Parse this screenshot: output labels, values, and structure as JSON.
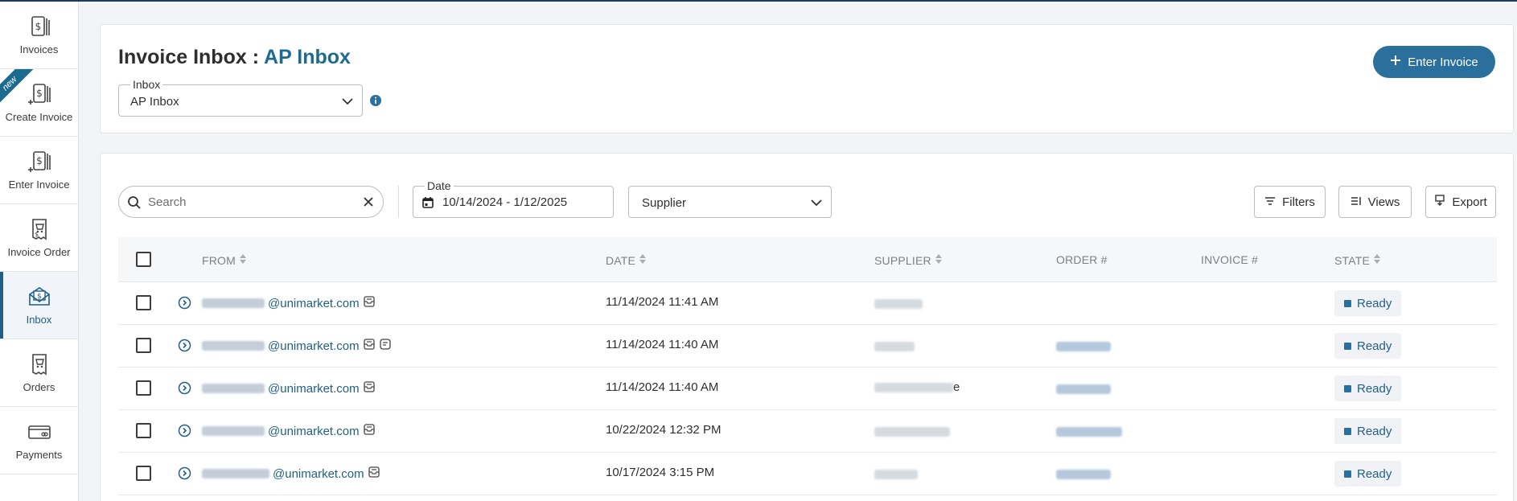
{
  "sidebar": {
    "items": [
      {
        "label": "Invoices",
        "icon": "invoices-icon"
      },
      {
        "label": "Create Invoice",
        "icon": "create-invoice-icon",
        "badge": "new"
      },
      {
        "label": "Enter Invoice",
        "icon": "enter-invoice-icon"
      },
      {
        "label": "Invoice Order",
        "icon": "invoice-order-icon"
      },
      {
        "label": "Inbox",
        "icon": "inbox-icon",
        "active": true
      },
      {
        "label": "Orders",
        "icon": "orders-icon"
      },
      {
        "label": "Payments",
        "icon": "payments-icon"
      }
    ]
  },
  "header": {
    "title_prefix": "Invoice Inbox : ",
    "title_accent": "AP Inbox",
    "inbox_label": "Inbox",
    "inbox_value": "AP Inbox",
    "enter_invoice_label": "Enter Invoice"
  },
  "toolbar": {
    "search_placeholder": "Search",
    "date_label": "Date",
    "date_value": "10/14/2024 - 1/12/2025",
    "supplier_value": "Supplier",
    "filters_label": "Filters",
    "views_label": "Views",
    "export_label": "Export"
  },
  "table": {
    "columns": {
      "from": "FROM",
      "date": "DATE",
      "supplier": "SUPPLIER",
      "order": "ORDER #",
      "invoice": "INVOICE #",
      "state": "STATE"
    },
    "rows": [
      {
        "domain": "@unimarket.com",
        "date": "11/14/2024 11:41 AM",
        "state": "Ready",
        "has_note": false,
        "has_order": false
      },
      {
        "domain": "@unimarket.com",
        "date": "11/14/2024 11:40 AM",
        "state": "Ready",
        "has_note": true,
        "has_order": true
      },
      {
        "domain": "@unimarket.com",
        "date": "11/14/2024 11:40 AM",
        "state": "Ready",
        "has_note": false,
        "has_order": true,
        "supplier_suffix": "e"
      },
      {
        "domain": "@unimarket.com",
        "date": "10/22/2024 12:32 PM",
        "state": "Ready",
        "has_note": false,
        "has_order": true
      },
      {
        "domain": "@unimarket.com",
        "date": "10/17/2024 3:15 PM",
        "state": "Ready",
        "has_note": false,
        "has_order": true
      }
    ]
  },
  "colors": {
    "accent": "#1f6b90",
    "primary_button": "#2b6f9c",
    "sidebar_active": "#1f5f86"
  }
}
